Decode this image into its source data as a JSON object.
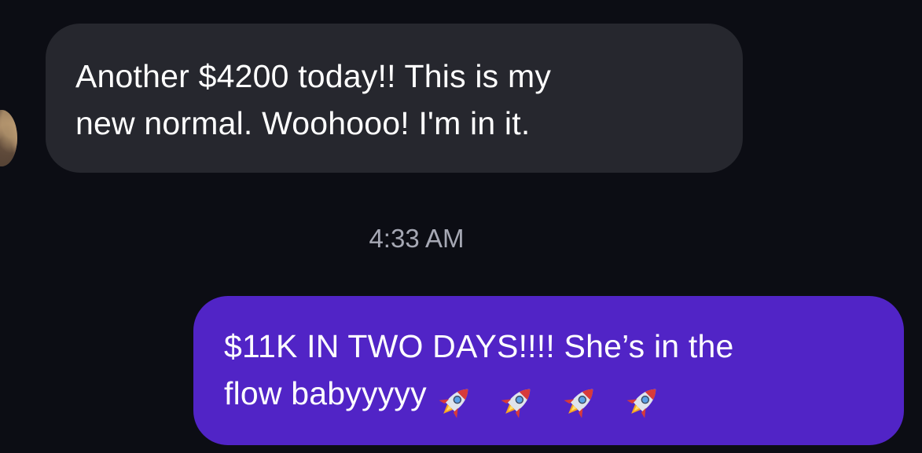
{
  "messages": {
    "incoming": {
      "line1": "Another $4200 today!! This is my",
      "line2": "new normal. Woohooo! I'm in it."
    },
    "timestamp": "4:33 AM",
    "outgoing": {
      "line1": "$11K IN TWO DAYS!!!! She’s in the",
      "line2": "flow babyyyyy",
      "emoji_icons": [
        "rocket-icon",
        "rocket-icon",
        "rocket-icon",
        "rocket-icon"
      ]
    }
  },
  "colors": {
    "background": "#0c0d14",
    "incoming_bubble": "#26272e",
    "outgoing_bubble": "#5124c6",
    "text": "#ffffff",
    "timestamp": "#a6a8b4"
  }
}
